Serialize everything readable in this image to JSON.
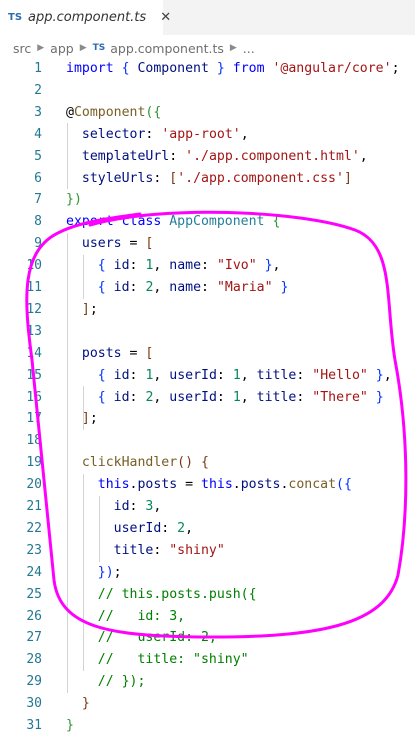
{
  "tab": {
    "badge": "TS",
    "title": "app.component.ts",
    "close": "✕"
  },
  "breadcrumb": {
    "items": [
      "src",
      "app",
      "app.component.ts",
      "..."
    ],
    "ts_badge": "TS"
  },
  "editor": {
    "lines": [
      {
        "n": "1",
        "tokens": [
          [
            "kw",
            "import "
          ],
          [
            "br",
            "{ "
          ],
          [
            "vr",
            "Component "
          ],
          [
            "br",
            "} "
          ],
          [
            "kw",
            "from "
          ],
          [
            "str",
            "'@angular/core'"
          ],
          [
            "",
            "; "
          ]
        ]
      },
      {
        "n": "2",
        "tokens": []
      },
      {
        "n": "3",
        "tokens": [
          [
            "",
            "@"
          ],
          [
            "fn",
            "Component"
          ],
          [
            "br2",
            "({"
          ]
        ]
      },
      {
        "n": "4",
        "tokens": [
          [
            "",
            "  "
          ],
          [
            "vr",
            "selector"
          ],
          [
            "",
            ": "
          ],
          [
            "str",
            "'app-root'"
          ],
          [
            "",
            ","
          ]
        ]
      },
      {
        "n": "5",
        "tokens": [
          [
            "",
            "  "
          ],
          [
            "vr",
            "templateUrl"
          ],
          [
            "",
            ": "
          ],
          [
            "str",
            "'./app.component.html'"
          ],
          [
            "",
            ","
          ]
        ]
      },
      {
        "n": "6",
        "tokens": [
          [
            "",
            "  "
          ],
          [
            "vr",
            "styleUrls"
          ],
          [
            "",
            ": "
          ],
          [
            "br3",
            "["
          ],
          [
            "str",
            "'./app.component.css'"
          ],
          [
            "br3",
            "]"
          ]
        ]
      },
      {
        "n": "7",
        "tokens": [
          [
            "br2",
            "})"
          ]
        ]
      },
      {
        "n": "8",
        "tokens": [
          [
            "kw",
            "export "
          ],
          [
            "kw",
            "class "
          ],
          [
            "ty",
            "AppComponent "
          ],
          [
            "br2",
            "{"
          ]
        ]
      },
      {
        "n": "9",
        "tokens": [
          [
            "",
            "  "
          ],
          [
            "vr",
            "users"
          ],
          [
            "",
            " = "
          ],
          [
            "br3",
            "["
          ]
        ]
      },
      {
        "n": "10",
        "tokens": [
          [
            "",
            "    "
          ],
          [
            "br",
            "{ "
          ],
          [
            "vr",
            "id"
          ],
          [
            "",
            ": "
          ],
          [
            "num",
            "1"
          ],
          [
            "",
            ", "
          ],
          [
            "vr",
            "name"
          ],
          [
            "",
            ": "
          ],
          [
            "str",
            "\"Ivo\" "
          ],
          [
            "br",
            "}"
          ],
          [
            "",
            ","
          ]
        ]
      },
      {
        "n": "11",
        "tokens": [
          [
            "",
            "    "
          ],
          [
            "br",
            "{ "
          ],
          [
            "vr",
            "id"
          ],
          [
            "",
            ": "
          ],
          [
            "num",
            "2"
          ],
          [
            "",
            ", "
          ],
          [
            "vr",
            "name"
          ],
          [
            "",
            ": "
          ],
          [
            "str",
            "\"Maria\" "
          ],
          [
            "br",
            "}"
          ]
        ]
      },
      {
        "n": "12",
        "tokens": [
          [
            "",
            "  "
          ],
          [
            "br3",
            "]"
          ],
          [
            "",
            ";"
          ]
        ]
      },
      {
        "n": "13",
        "tokens": []
      },
      {
        "n": "14",
        "tokens": [
          [
            "",
            "  "
          ],
          [
            "vr",
            "posts"
          ],
          [
            "",
            " = "
          ],
          [
            "br3",
            "["
          ]
        ]
      },
      {
        "n": "15",
        "tokens": [
          [
            "",
            "    "
          ],
          [
            "br",
            "{ "
          ],
          [
            "vr",
            "id"
          ],
          [
            "",
            ": "
          ],
          [
            "num",
            "1"
          ],
          [
            "",
            ", "
          ],
          [
            "vr",
            "userId"
          ],
          [
            "",
            ": "
          ],
          [
            "num",
            "1"
          ],
          [
            "",
            ", "
          ],
          [
            "vr",
            "title"
          ],
          [
            "",
            ": "
          ],
          [
            "str",
            "\"Hello\" "
          ],
          [
            "br",
            "}"
          ],
          [
            "",
            ","
          ]
        ]
      },
      {
        "n": "16",
        "tokens": [
          [
            "",
            "    "
          ],
          [
            "br",
            "{ "
          ],
          [
            "vr",
            "id"
          ],
          [
            "",
            ": "
          ],
          [
            "num",
            "2"
          ],
          [
            "",
            ", "
          ],
          [
            "vr",
            "userId"
          ],
          [
            "",
            ": "
          ],
          [
            "num",
            "1"
          ],
          [
            "",
            ", "
          ],
          [
            "vr",
            "title"
          ],
          [
            "",
            ": "
          ],
          [
            "str",
            "\"There\" "
          ],
          [
            "br",
            "}"
          ]
        ]
      },
      {
        "n": "17",
        "tokens": [
          [
            "",
            "  "
          ],
          [
            "br3",
            "]"
          ],
          [
            "",
            ";"
          ]
        ]
      },
      {
        "n": "18",
        "tokens": []
      },
      {
        "n": "19",
        "tokens": [
          [
            "",
            "  "
          ],
          [
            "fn",
            "clickHandler"
          ],
          [
            "br3",
            "() {"
          ]
        ]
      },
      {
        "n": "20",
        "tokens": [
          [
            "",
            "    "
          ],
          [
            "kw",
            "this"
          ],
          [
            "",
            "."
          ],
          [
            "vr",
            "posts"
          ],
          [
            "",
            " = "
          ],
          [
            "kw",
            "this"
          ],
          [
            "",
            "."
          ],
          [
            "vr",
            "posts"
          ],
          [
            "",
            "."
          ],
          [
            "fn",
            "concat"
          ],
          [
            "br",
            "({"
          ]
        ]
      },
      {
        "n": "21",
        "tokens": [
          [
            "",
            "      "
          ],
          [
            "vr",
            "id"
          ],
          [
            "",
            ": "
          ],
          [
            "num",
            "3"
          ],
          [
            "",
            ","
          ]
        ]
      },
      {
        "n": "22",
        "tokens": [
          [
            "",
            "      "
          ],
          [
            "vr",
            "userId"
          ],
          [
            "",
            ": "
          ],
          [
            "num",
            "2"
          ],
          [
            "",
            ","
          ]
        ]
      },
      {
        "n": "23",
        "tokens": [
          [
            "",
            "      "
          ],
          [
            "vr",
            "title"
          ],
          [
            "",
            ": "
          ],
          [
            "str",
            "\"shiny\""
          ]
        ]
      },
      {
        "n": "24",
        "tokens": [
          [
            "",
            "    "
          ],
          [
            "br",
            "})"
          ],
          [
            "",
            ";"
          ]
        ]
      },
      {
        "n": "25",
        "tokens": [
          [
            "",
            "    "
          ],
          [
            "cm",
            "// this.posts.push({"
          ]
        ]
      },
      {
        "n": "26",
        "tokens": [
          [
            "",
            "    "
          ],
          [
            "cm",
            "//   id: 3,"
          ]
        ]
      },
      {
        "n": "27",
        "tokens": [
          [
            "",
            "    "
          ],
          [
            "cm",
            "//   userId: 2,"
          ]
        ]
      },
      {
        "n": "28",
        "tokens": [
          [
            "",
            "    "
          ],
          [
            "cm",
            "//   title: \"shiny\""
          ]
        ]
      },
      {
        "n": "29",
        "tokens": [
          [
            "",
            "    "
          ],
          [
            "cm",
            "// });"
          ]
        ]
      },
      {
        "n": "30",
        "tokens": [
          [
            "",
            "  "
          ],
          [
            "br3",
            "}"
          ]
        ]
      },
      {
        "n": "31",
        "tokens": [
          [
            "br2",
            "}"
          ]
        ]
      }
    ]
  },
  "colors": {
    "annotation": "#ff00ff"
  }
}
